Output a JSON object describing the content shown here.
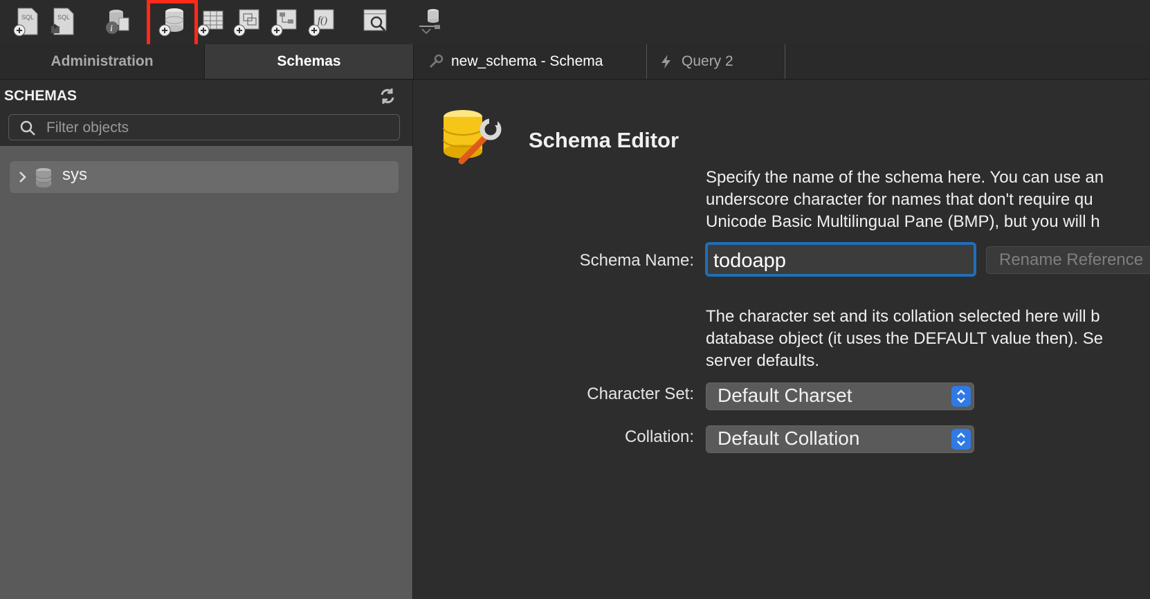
{
  "toolbar": {
    "icons": [
      "new-sql-tab-icon",
      "open-sql-script-icon",
      "inspector-icon",
      "create-schema-icon",
      "create-table-icon",
      "create-view-icon",
      "create-procedure-icon",
      "create-function-icon",
      "search-table-data-icon",
      "reconnect-icon"
    ]
  },
  "tabs": {
    "administration": "Administration",
    "schemas": "Schemas",
    "schema_editor": "new_schema - Schema",
    "query": "Query 2"
  },
  "sidebar": {
    "title": "SCHEMAS",
    "filter_placeholder": "Filter objects",
    "tree": [
      {
        "label": "sys"
      }
    ]
  },
  "editor": {
    "title": "Schema Editor",
    "desc1": [
      "Specify the name of the schema here. You can use an",
      "underscore character for names that don't require qu",
      "Unicode Basic Multilingual Pane (BMP), but you will h"
    ],
    "name_label": "Schema Name:",
    "name_value": "todoapp",
    "rename_button": "Rename Reference",
    "desc2": [
      "The character set and its collation selected here will b",
      "database object (it uses the DEFAULT value then). Se",
      "server defaults."
    ],
    "charset_label": "Character Set:",
    "charset_value": "Default Charset",
    "collation_label": "Collation:",
    "collation_value": "Default Collation"
  },
  "colors": {
    "highlight": "#ff2a1a",
    "focus_ring": "#1f6fb8",
    "stepper": "#2f7ae6"
  }
}
